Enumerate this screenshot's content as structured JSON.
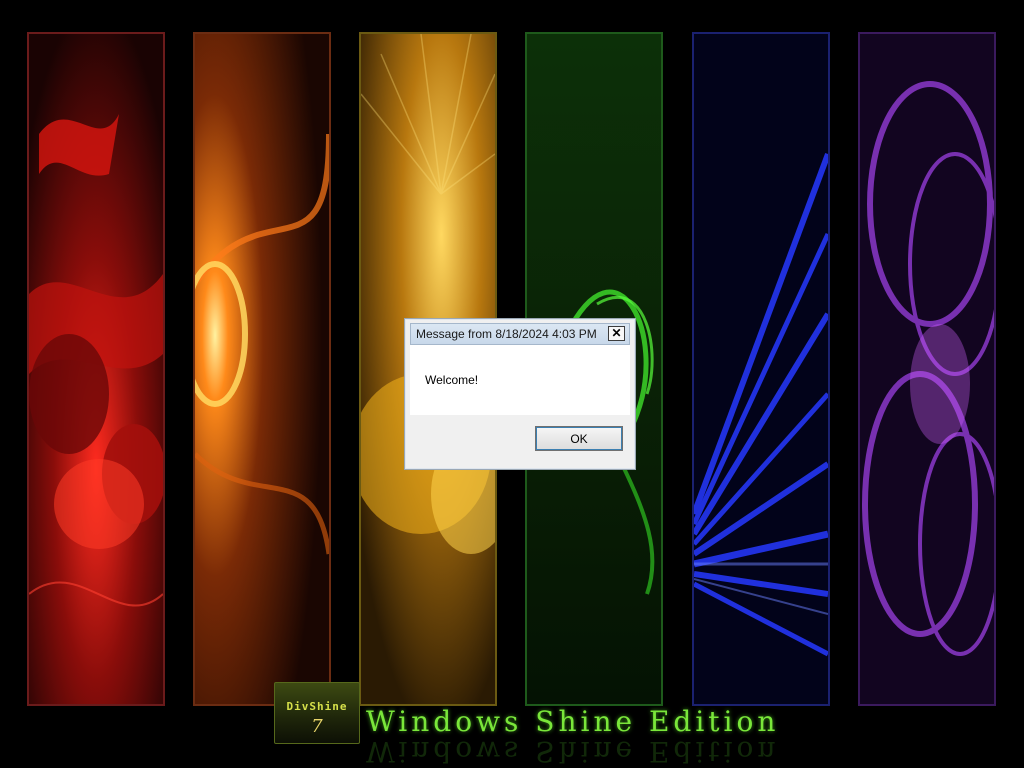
{
  "wallpaper": {
    "panels": [
      {
        "name": "red",
        "color": "#e0201a"
      },
      {
        "name": "orange",
        "color": "#f07a10"
      },
      {
        "name": "yellow",
        "color": "#f2b81e"
      },
      {
        "name": "green",
        "color": "#2fbf1e"
      },
      {
        "name": "blue",
        "color": "#2436e8"
      },
      {
        "name": "purple",
        "color": "#a13ee0"
      }
    ],
    "branding": {
      "logo_name": "DivShine",
      "logo_number": "7",
      "title": "Windows Shine Edition",
      "title_color": "#7ae63a"
    }
  },
  "dialog": {
    "title": "Message from  8/18/2024 4:03 PM",
    "close_icon": "close-icon",
    "message": "Welcome!",
    "ok_label": "OK"
  }
}
